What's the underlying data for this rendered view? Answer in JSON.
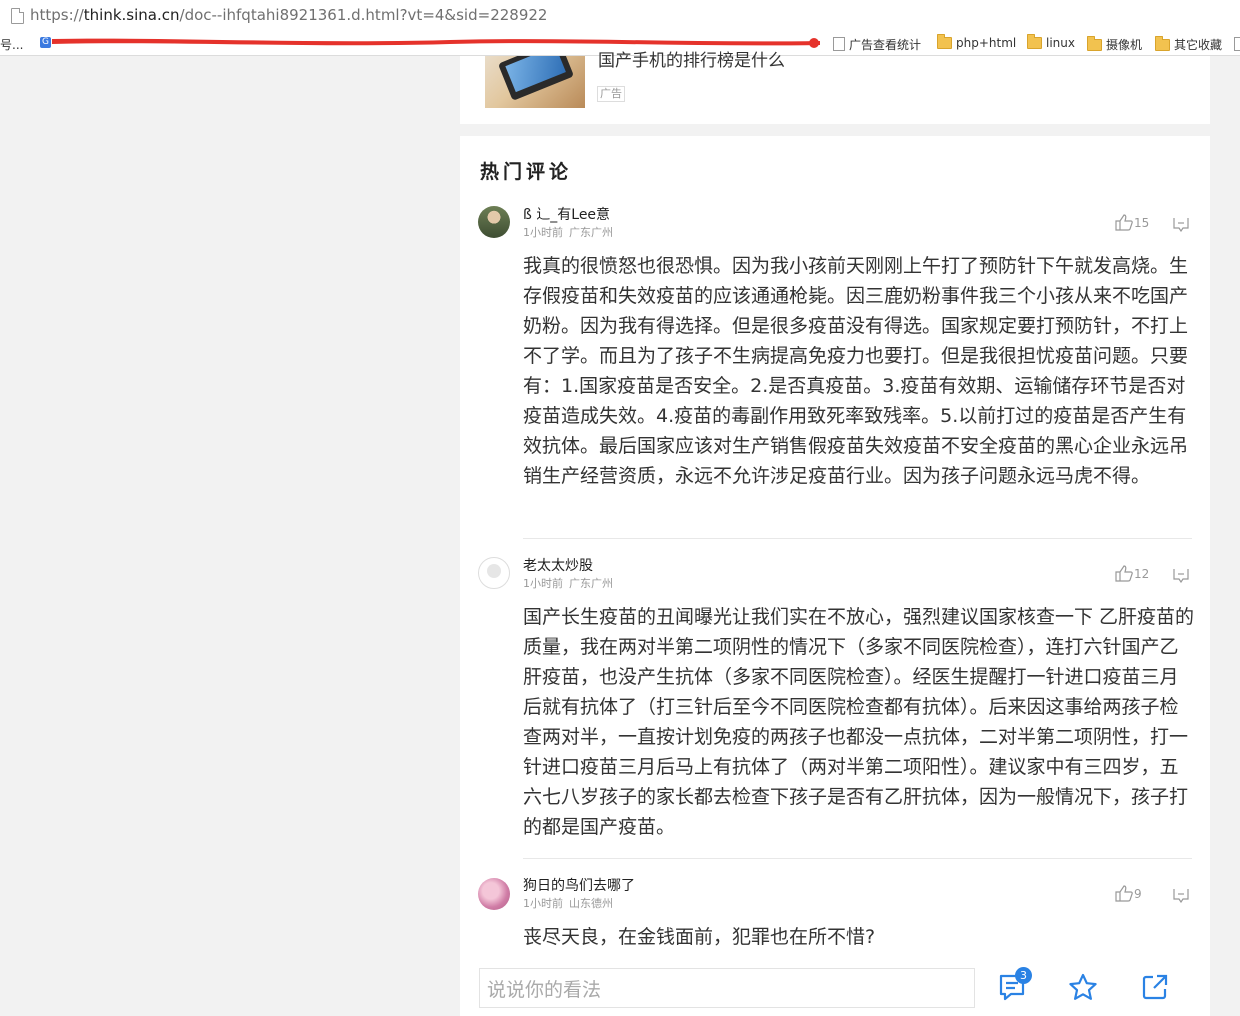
{
  "browser": {
    "url_prefix": "https://",
    "url_host": "think.sina.cn",
    "url_path": "/doc--ihfqtahi8921361.d.html?vt=4&sid=228922",
    "bookmarks": {
      "first_truncated": "号...",
      "items": [
        {
          "label": "广告查看统计",
          "icon": "doc-icon"
        },
        {
          "label": "php+html",
          "icon": "folder-icon"
        },
        {
          "label": "linux",
          "icon": "folder-icon"
        },
        {
          "label": "摄像机",
          "icon": "folder-icon"
        },
        {
          "label": "其它收藏",
          "icon": "folder-icon"
        }
      ]
    }
  },
  "ad": {
    "title": "国产手机的排行榜是什么",
    "label": "广告"
  },
  "section": {
    "title": "热门评论"
  },
  "comments": [
    {
      "user": "ß 辶_有Lee意",
      "time": "1小时前",
      "location": "广东广州",
      "likes": "15",
      "text": "我真的很愤怒也很恐惧。因为我小孩前天刚刚上午打了预防针下午就发高烧。生存假疫苗和失效疫苗的应该通通枪毙。因三鹿奶粉事件我三个小孩从来不吃国产奶粉。因为我有得选择。但是很多疫苗没有得选。国家规定要打预防针，不打上不了学。而且为了孩子不生病提高免疫力也要打。但是我很担忧疫苗问题。只要有：1.国家疫苗是否安全。2.是否真疫苗。3.疫苗有效期、运输储存环节是否对疫苗造成失效。4.疫苗的毒副作用致死率致残率。5.以前打过的疫苗是否产生有效抗体。最后国家应该对生产销售假疫苗失效疫苗不安全疫苗的黑心企业永远吊销生产经营资质，永远不允许涉足疫苗行业。因为孩子问题永远马虎不得。"
    },
    {
      "user": "老太太炒股",
      "time": "1小时前",
      "location": "广东广州",
      "likes": "12",
      "text": "国产长生疫苗的丑闻曝光让我们实在不放心，强烈建议国家核查一下 乙肝疫苗的质量，我在两对半第二项阴性的情况下（多家不同医院检查），连打六针国产乙肝疫苗，也没产生抗体（多家不同医院检查）。经医生提醒打一针进口疫苗三月后就有抗体了（打三针后至今不同医院检查都有抗体）。后来因这事给两孩子检查两对半，一直按计划免疫的两孩子也都没一点抗体，二对半第二项阴性，打一针进口疫苗三月后马上有抗体了（两对半第二项阳性）。建议家中有三四岁，五六七八岁孩子的家长都去检查下孩子是否有乙肝抗体，因为一般情况下，孩子打的都是国产疫苗。"
    },
    {
      "user": "狗日的鸟们去哪了",
      "time": "1小时前",
      "location": "山东德州",
      "likes": "9",
      "text": "丧尽天良，在金钱面前，犯罪也在所不惜?"
    }
  ],
  "footer": {
    "input_placeholder": "说说你的看法",
    "comment_count": "3"
  },
  "colors": {
    "accent": "#2a82e4",
    "redaction": "#e5322b"
  }
}
